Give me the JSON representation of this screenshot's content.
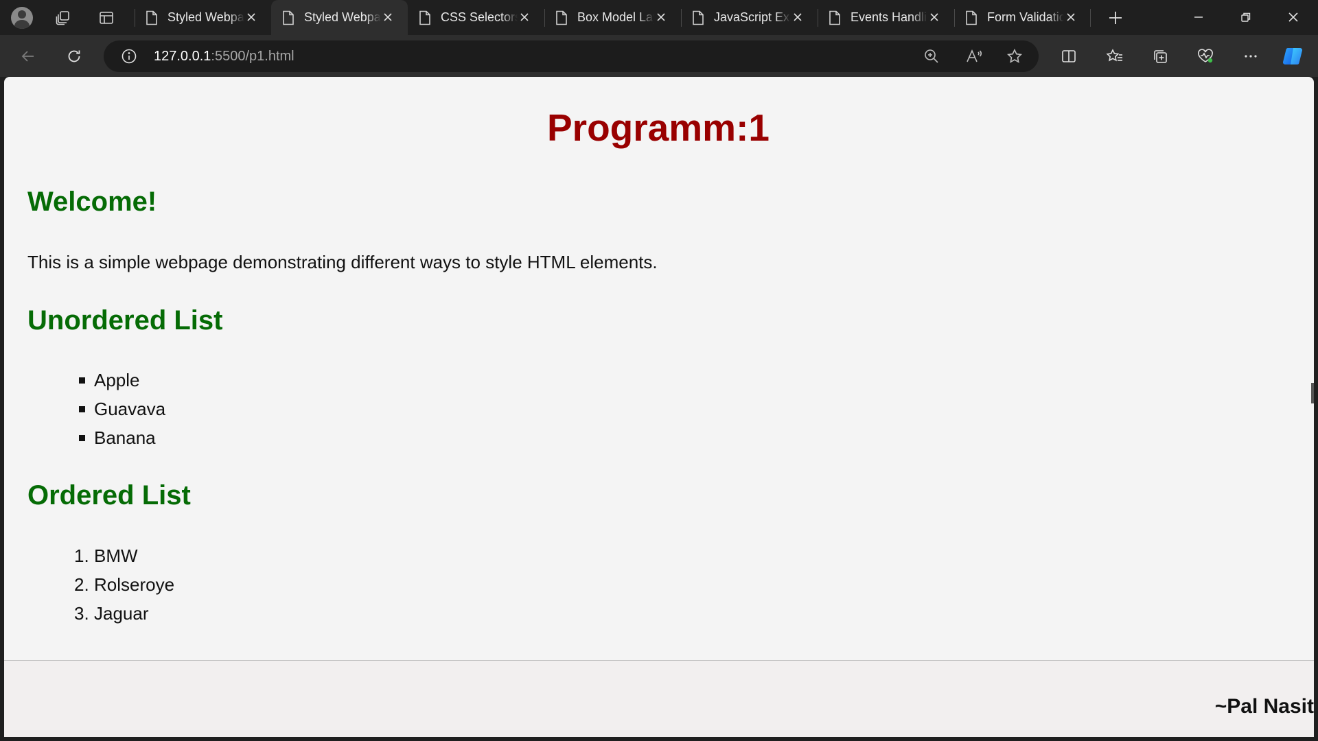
{
  "browser": {
    "tabs": [
      {
        "title": "Styled Webpage",
        "active": false
      },
      {
        "title": "Styled Webpage",
        "active": true
      },
      {
        "title": "CSS Selectors",
        "active": false
      },
      {
        "title": "Box Model Layout",
        "active": false
      },
      {
        "title": "JavaScript Example",
        "active": false
      },
      {
        "title": "Events Handling",
        "active": false
      },
      {
        "title": "Form Validation",
        "active": false
      }
    ],
    "address": {
      "host": "127.0.0.1",
      "rest": ":5500/p1.html"
    }
  },
  "page": {
    "title": "Programm:1",
    "welcome_heading": "Welcome!",
    "intro": "This is a simple webpage demonstrating different ways to style HTML elements.",
    "unordered_heading": "Unordered List",
    "unordered_items": [
      "Apple",
      "Guavava",
      "Banana"
    ],
    "ordered_heading": "Ordered List",
    "ordered_items": [
      "BMW",
      "Rolseroye",
      "Jaguar"
    ],
    "ordered_numbers": [
      "1.",
      "2.",
      "3."
    ],
    "footer_signature": "~Pal Nasit"
  },
  "colors": {
    "title": "#990000",
    "heading": "#056b05",
    "page_bg": "#f4f4f4",
    "chrome_bg": "#1f1f1f",
    "toolbar_bg": "#2e2e2e"
  }
}
